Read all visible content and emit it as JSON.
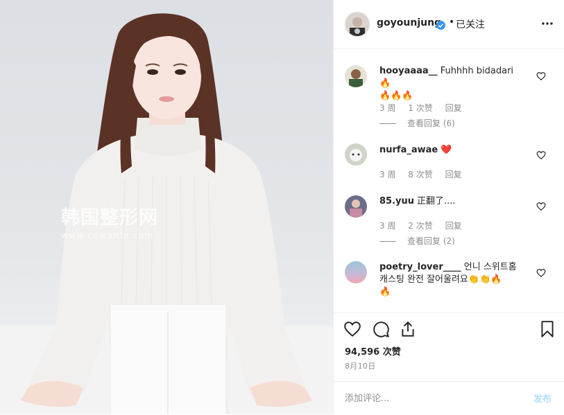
{
  "header": {
    "username": "goyounjung",
    "dot": "•",
    "follow_label": "已关注",
    "more_icon": "more-horizontal-icon",
    "verified_icon": "verified-badge-icon"
  },
  "photo": {
    "watermark_cn": "韩国整形网",
    "watermark_url": "www.cnwanle.com"
  },
  "comments": [
    {
      "username": "hooyaaaa__",
      "text_line1": "Fuhhhh bidadari 🔥",
      "text_line2": "🔥🔥🔥",
      "time": "3 周",
      "likes": "1 次赞",
      "reply": "回复",
      "view_replies": "查看回复 (6)"
    },
    {
      "username": "nurfa_awae",
      "text_line1": "❤️",
      "text_line2": "",
      "time": "3 周",
      "likes": "8 次赞",
      "reply": "回复",
      "view_replies": ""
    },
    {
      "username": "85.yuu",
      "text_line1": "正翻了....",
      "text_line2": "",
      "time": "3 周",
      "likes": "2 次赞",
      "reply": "回复",
      "view_replies": "查看回复 (2)"
    },
    {
      "username": "poetry_lover____",
      "text_line1": "언니 스위트홈",
      "text_line2": "캐스팅 완전 잘어울려요👏👏🔥",
      "text_line3": "🔥",
      "time": "",
      "likes": "",
      "reply": "",
      "view_replies": ""
    }
  ],
  "actions": {
    "like_icon": "heart-icon",
    "comment_icon": "comment-icon",
    "share_icon": "share-icon",
    "save_icon": "bookmark-icon",
    "likes_count": "94,596 次赞",
    "date": "8月10日"
  },
  "add_comment": {
    "placeholder": "添加评论...",
    "post_label": "发布"
  },
  "colors": {
    "verified_blue": "#3897f0",
    "muted_text": "#8e8e8e",
    "post_disabled": "#b2dffc",
    "divider": "#efefef"
  }
}
